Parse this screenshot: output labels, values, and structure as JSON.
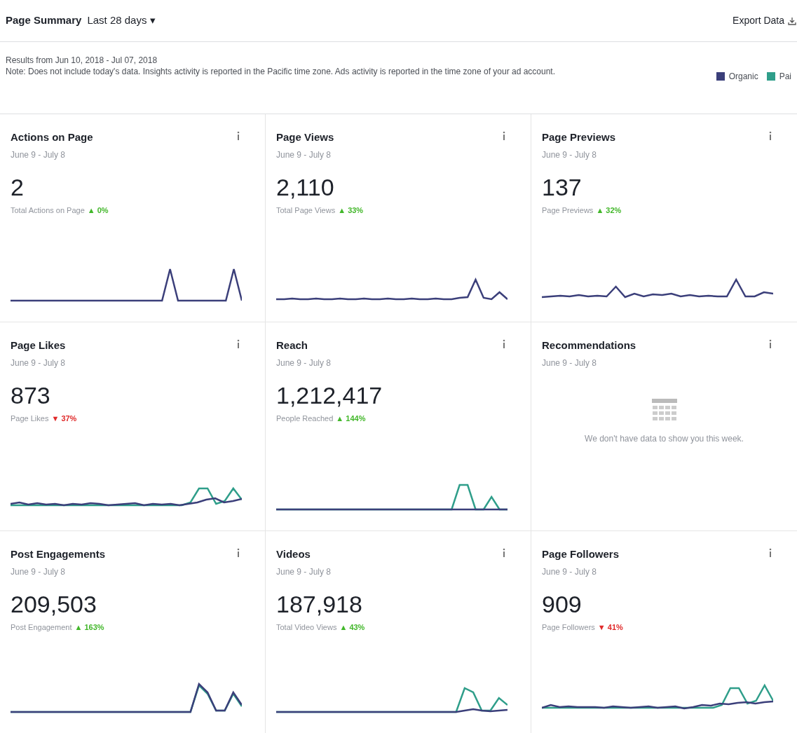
{
  "header": {
    "title": "Page Summary",
    "range": "Last 28 days",
    "range_caret": "▾",
    "export": "Export Data"
  },
  "notice": {
    "results": "Results from Jun 10, 2018 - Jul 07, 2018",
    "note": "Note: Does not include today's data. Insights activity is reported in the Pacific time zone. Ads activity is reported in the time zone of your ad account."
  },
  "legend": [
    {
      "label": "Organic",
      "color": "#3b3f7a"
    },
    {
      "label": "Pai",
      "color": "#2f9e8a"
    }
  ],
  "cards": [
    {
      "title": "Actions on Page",
      "dates": "June 9 - July 8",
      "kind": "sparkline",
      "value": "2",
      "metric": "Total Actions on Page",
      "increase": true,
      "change": "▲ 0%"
    },
    {
      "title": "Page Views",
      "dates": "June 9 - July 8",
      "kind": "sparkline",
      "value": "2,110",
      "metric": "Total Page Views",
      "increase": true,
      "change": "▲ 33%"
    },
    {
      "title": "Page Previews",
      "dates": "June 9 - July 8",
      "kind": "sparkline",
      "value": "137",
      "metric": "Page Previews",
      "increase": true,
      "change": "▲ 32%"
    },
    {
      "title": "Page Likes",
      "dates": "June 9 - July 8",
      "kind": "sparkline",
      "value": "873",
      "metric": "Page Likes",
      "increase": false,
      "change": "▼ 37%"
    },
    {
      "title": "Reach",
      "dates": "June 9 - July 8",
      "kind": "sparkline",
      "value": "1,212,417",
      "metric": "People Reached",
      "increase": true,
      "change": "▲ 144%"
    },
    {
      "title": "Recommendations",
      "dates": "June 9 - July 8",
      "kind": "empty",
      "message": "We don't have data to show you this week."
    },
    {
      "title": "Post Engagements",
      "dates": "June 9 - July 8",
      "kind": "sparkline",
      "value": "209,503",
      "metric": "Post Engagement",
      "increase": true,
      "change": "▲ 163%"
    },
    {
      "title": "Videos",
      "dates": "June 9 - July 8",
      "kind": "sparkline",
      "value": "187,918",
      "metric": "Total Video Views",
      "increase": true,
      "change": "▲ 43%"
    },
    {
      "title": "Page Followers",
      "dates": "June 9 - July 8",
      "kind": "sparkline",
      "value": "909",
      "metric": "Page Followers",
      "increase": false,
      "change": "▼ 41%"
    }
  ]
}
